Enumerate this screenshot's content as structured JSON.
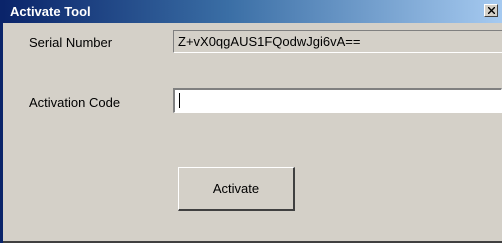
{
  "window": {
    "title": "Activate Tool"
  },
  "form": {
    "serial_label": "Serial Number",
    "serial_value": "Z+vX0qgAUS1FQodwJgi6vA==",
    "code_label": "Activation Code",
    "code_value": "",
    "activate_label": "Activate"
  },
  "icons": {
    "close": "close-icon"
  },
  "colors": {
    "title_bar_start": "#0a246a",
    "title_bar_end": "#a6caf0",
    "window_face": "#d4d0c8",
    "input_background": "#ffffff"
  }
}
